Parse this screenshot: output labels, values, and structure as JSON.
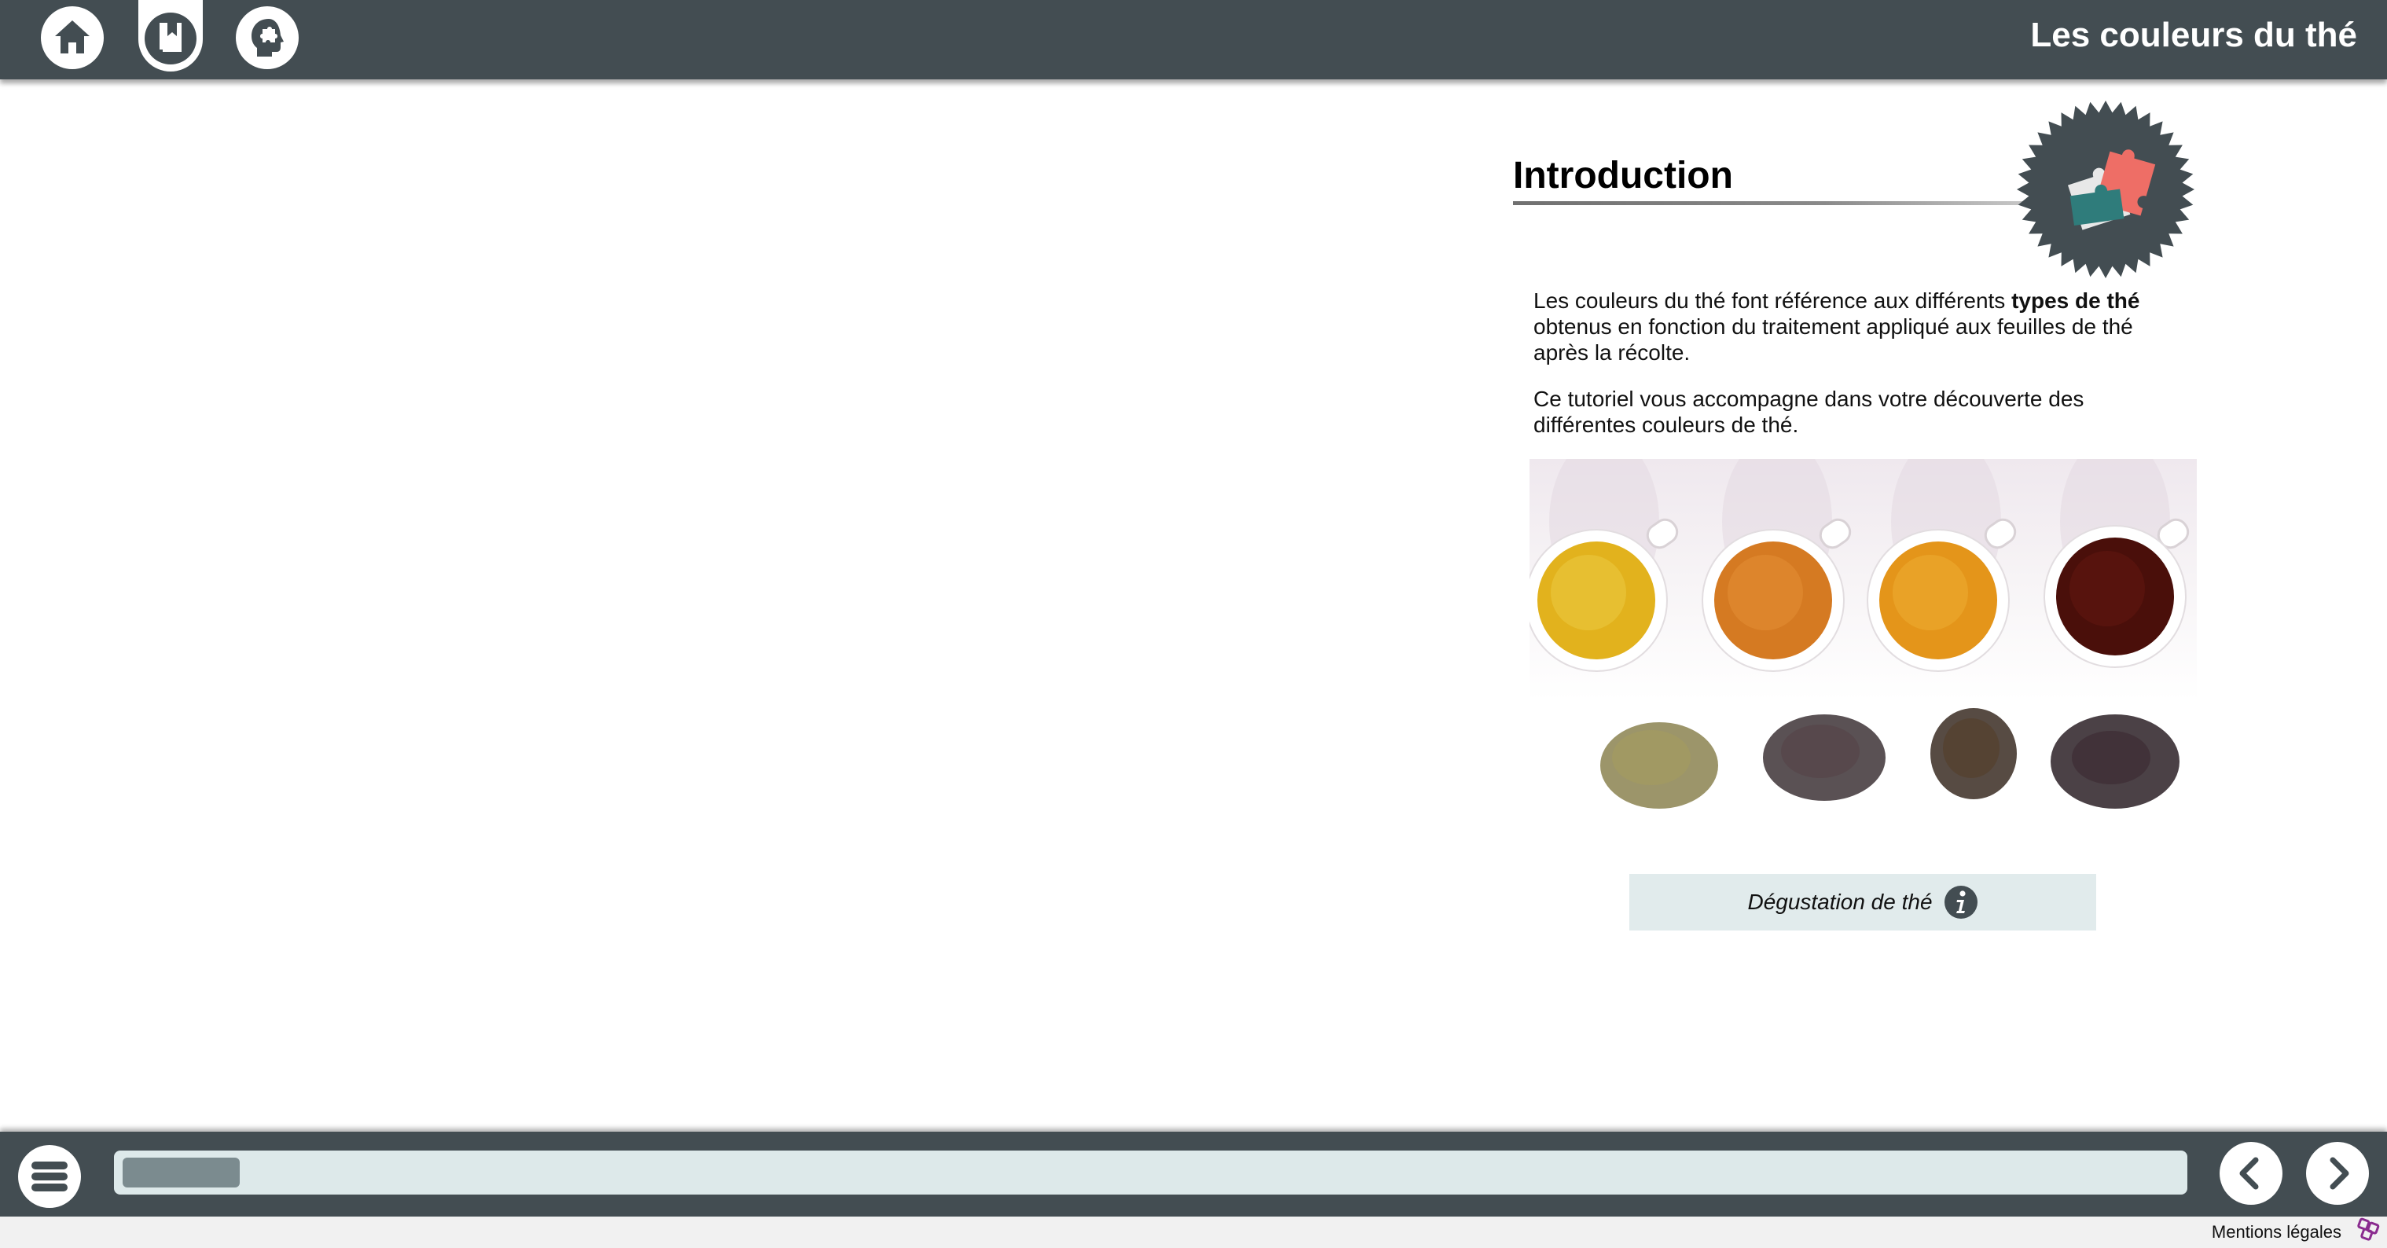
{
  "header": {
    "title": "Les couleurs du thé",
    "buttons": [
      {
        "icon": "home-icon"
      },
      {
        "icon": "bookmark-book-icon"
      },
      {
        "icon": "head-puzzle-icon"
      }
    ],
    "background_color": "#434d52"
  },
  "content": {
    "section_title": "Introduction",
    "badge_icon": "puzzle-pieces-badge-icon",
    "paragraph1_before": "Les couleurs du thé font référence aux différents ",
    "paragraph1_bold": "types de thé",
    "paragraph1_after": " obtenus en fonction du traitement appliqué aux feuilles de thé après la récolte.",
    "paragraph2": "Ce tutoriel vous accompagne dans votre découverte des différentes couleurs de thé.",
    "caption": "Dégustation de thé",
    "caption_icon": "info-icon",
    "caption_background": "#e1ebec"
  },
  "footer": {
    "menu_icon": "hamburger-menu-icon",
    "progress_fraction": 0.057,
    "prev_icon": "chevron-left-icon",
    "next_icon": "chevron-right-icon",
    "legal_link": "Mentions légales",
    "legal_logo": "brand-logo-icon"
  }
}
